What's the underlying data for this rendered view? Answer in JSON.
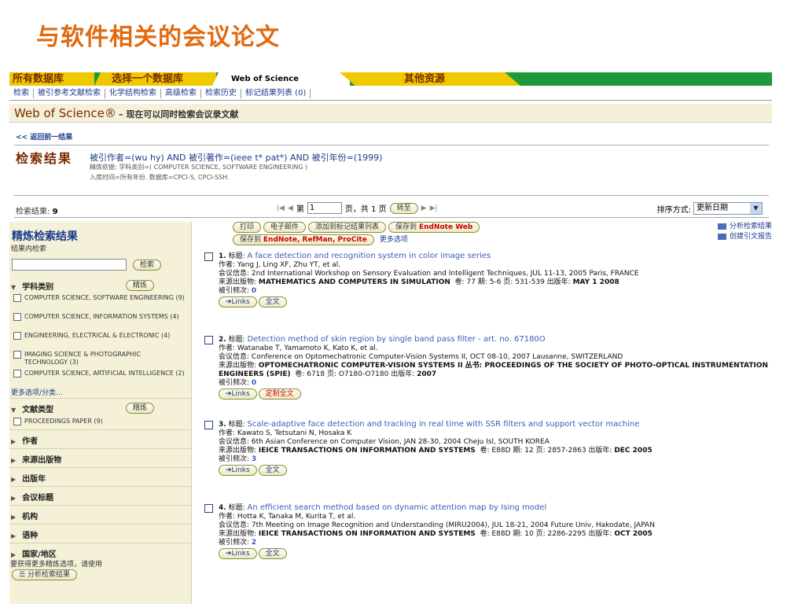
{
  "slide_title": "与软件相关的会议论文",
  "topnav": {
    "all_db": "所有数据库",
    "choose_db": "选择一个数据库",
    "wos": "Web of Science",
    "other": "其他资源"
  },
  "subnav": [
    "检索",
    "被引参考文献检索",
    "化学结构检索",
    "高级检索",
    "检索历史",
    "标记结果列表 (0)"
  ],
  "banner": {
    "brand": "Web of Science®",
    "text": "– 现在可以同时检索会议录文献"
  },
  "back_link": "<< 返回前一结果",
  "results": {
    "heading": "检索结果",
    "query": "被引作者=(wu hy) AND 被引著作=(ieee t* pat*) AND 被引年份=(1999)",
    "refine_basis": "精炼依据: 学科类别=( COMPUTER SCIENCE, SOFTWARE ENGINEERING )",
    "timespan": "入库时间=所有年份. 数据库=CPCI-S, CPCI-SSH.",
    "count_label": "检索结果:",
    "count": "9"
  },
  "pager": {
    "page_prefix": "第",
    "page_value": "1",
    "page_suffix": "页，共 1 页",
    "go": "转至"
  },
  "sort": {
    "label": "排序方式:",
    "value": "更新日期"
  },
  "sidebar": {
    "title": "精炼检索结果",
    "search_within": "结果内检索",
    "search_btn": "检索",
    "subject_cat": "学科类别",
    "refine_btn": "精炼",
    "subjects": [
      "COMPUTER SCIENCE, SOFTWARE ENGINEERING (9)",
      "COMPUTER SCIENCE, INFORMATION SYSTEMS (4)",
      "ENGINEERING, ELECTRICAL & ELECTRONIC (4)",
      "IMAGING SCIENCE & PHOTOGRAPHIC TECHNOLOGY (3)",
      "COMPUTER SCIENCE, ARTIFICIAL INTELLIGENCE (2)"
    ],
    "more_options": "更多选项/分类…",
    "doc_type": "文献类型",
    "doc_types": [
      "PROCEEDINGS PAPER (9)"
    ],
    "collapsed": [
      "作者",
      "来源出版物",
      "出版年",
      "会议标题",
      "机构",
      "语种",
      "国家/地区"
    ],
    "analysis_note": "要获得更多精炼选项，请使用",
    "analysis_btn": "分析检索结果"
  },
  "actions": {
    "print": "打印",
    "email": "电子邮件",
    "add_marked": "添加到标记结果列表",
    "save_to": "保存到",
    "endnote_web": "EndNote Web",
    "save_to2": "保存到",
    "endnote_refman": "EndNote, RefMan, ProCite",
    "more_options": "更多选项",
    "analyze": "分析检索结果",
    "citation_report": "创建引文报告"
  },
  "records": [
    {
      "num": "1.",
      "title_label": "标题:",
      "title": "A face detection and recognition system in color image series",
      "authors_label": "作者:",
      "authors": "Yang J, Ling XF, Zhu YT, et al.",
      "conf_label": "会议信息:",
      "conf": "2nd International Workshop on Sensory Evaluation and Intelligent Techniques, JUL 11-13, 2005 Paris, FRANCE",
      "source_label": "来源出版物:",
      "source": "MATHEMATICS AND COMPUTERS IN SIMULATION",
      "details": "卷: 77  期: 5-6  页: 531-539  出版年:",
      "year": "MAY 1 2008",
      "cited_label": "被引频次:",
      "cited": "0",
      "links": "Links",
      "fulltext": "全文"
    },
    {
      "num": "2.",
      "title_label": "标题:",
      "title": "Detection method of skin region by single band pass filter - art. no. 67180O",
      "authors_label": "作者:",
      "authors": "Watanabe T, Yamamoto K, Kato K, et al.",
      "conf_label": "会议信息:",
      "conf": "Conference on Optomechatronic Computer-Vision Systems II, OCT 08-10, 2007 Lausanne, SWITZERLAND",
      "source_label": "来源出版物:",
      "source": "OPTOMECHATRONIC COMPUTER-VISION SYSTEMS II",
      "series": "丛书: PROCEEDINGS OF THE SOCIETY OF PHOTO-OPTICAL INSTRUMENTATION ENGINEERS (SPIE)",
      "details": "卷: 6718  页: O7180-O7180  出版年:",
      "year": "2007",
      "cited_label": "被引频次:",
      "cited": "0",
      "links": "Links",
      "fulltext": "定制全文"
    },
    {
      "num": "3.",
      "title_label": "标题:",
      "title": "Scale-adaptive face detection and tracking in real time with SSR filters and support vector machine",
      "authors_label": "作者:",
      "authors": "Kawato S, Tetsutani N, Hosaka K",
      "conf_label": "会议信息:",
      "conf": "6th Asian Conference on Computer Vision, JAN 28-30, 2004 Cheju Isl, SOUTH KOREA",
      "source_label": "来源出版物:",
      "source": "IEICE TRANSACTIONS ON INFORMATION AND SYSTEMS",
      "details": "卷: E88D  期: 12  页: 2857-2863  出版年:",
      "year": "DEC 2005",
      "cited_label": "被引频次:",
      "cited": "3",
      "links": "Links",
      "fulltext": "全文"
    },
    {
      "num": "4.",
      "title_label": "标题:",
      "title": "An efficient search method based on dynamic attention map by Ising model",
      "authors_label": "作者:",
      "authors": "Hotta K, Tanaka M, Kurita T, et al.",
      "conf_label": "会议信息:",
      "conf": "7th Meeting on Image Recognition and Understanding (MIRU2004), JUL 18-21, 2004 Future Univ, Hakodate, JAPAN",
      "source_label": "来源出版物:",
      "source": "IEICE TRANSACTIONS ON INFORMATION AND SYSTEMS",
      "details": "卷: E88D  期: 10  页: 2286-2295  出版年:",
      "year": "OCT 2005",
      "cited_label": "被引频次:",
      "cited": "2",
      "links": "Links",
      "fulltext": "全文"
    }
  ]
}
